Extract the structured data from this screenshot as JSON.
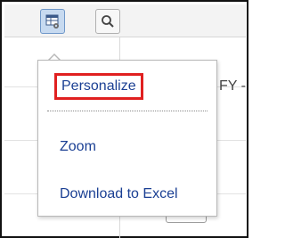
{
  "toolbar": {
    "personalize_icon": "table-settings-icon",
    "search_icon": "magnifier-icon"
  },
  "menu": {
    "items": [
      {
        "label": "Personalize",
        "highlighted": true
      },
      {
        "label": "Zoom"
      },
      {
        "label": "Download to Excel"
      }
    ]
  },
  "background": {
    "column_header_fragment": "FY -"
  },
  "colors": {
    "menu_text": "#1a3f93",
    "highlight_border": "#e02020",
    "active_button": "#c7daf0"
  }
}
